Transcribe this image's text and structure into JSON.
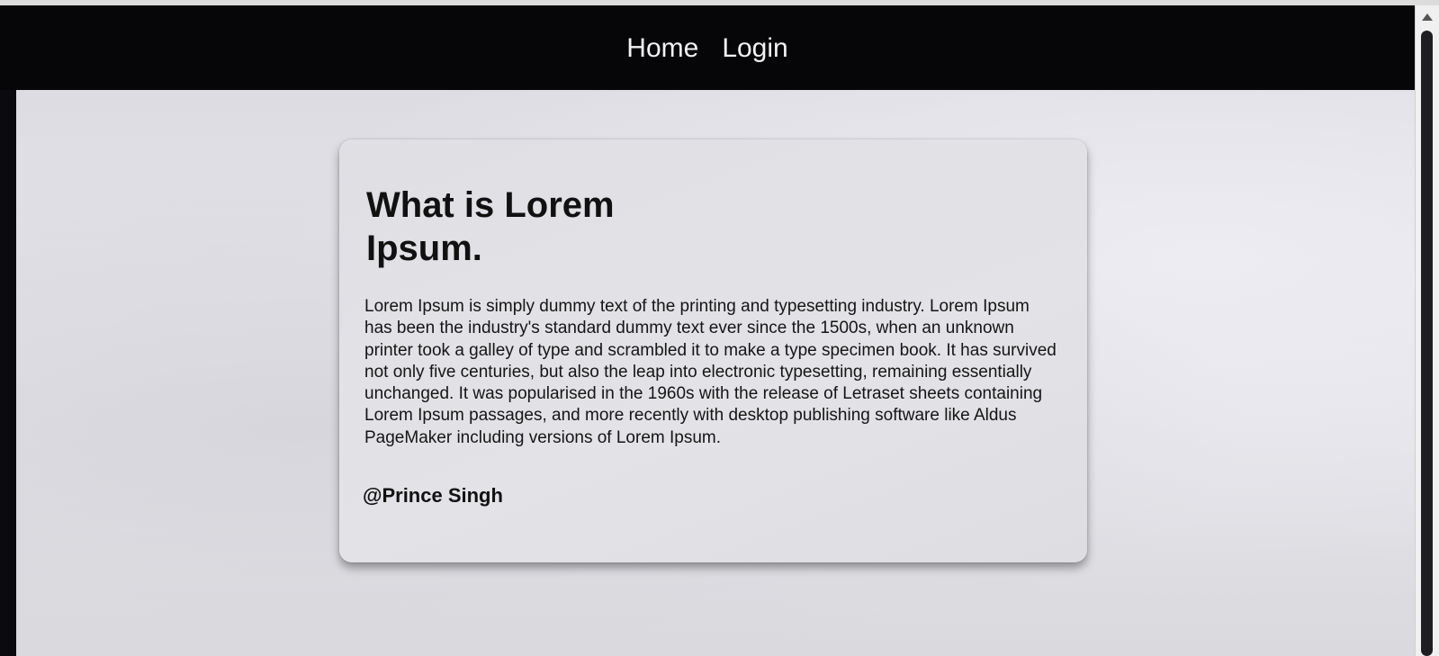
{
  "nav": {
    "items": [
      {
        "label": "Home"
      },
      {
        "label": "Login"
      }
    ]
  },
  "card": {
    "title": "What is Lorem Ipsum.",
    "body": "Lorem Ipsum is simply dummy text of the printing and typesetting industry. Lorem Ipsum has been the industry's standard dummy text ever since the 1500s, when an unknown printer took a galley of type and scrambled it to make a type specimen book. It has survived not only five centuries, but also the leap into electronic typesetting, remaining essentially unchanged. It was popularised in the 1960s with the release of Letraset sheets containing Lorem Ipsum passages, and more recently with desktop publishing software like Aldus PageMaker including versions of Lorem Ipsum.",
    "author": "@Prince Singh"
  },
  "scrollbar": {
    "up_icon": "chevron-up-icon"
  },
  "colors": {
    "navbar": "#060609",
    "nav_text": "#f2f2f2",
    "page_background": "#e0e0e6",
    "card_background": "#e1e1e5",
    "text": "#111111"
  }
}
